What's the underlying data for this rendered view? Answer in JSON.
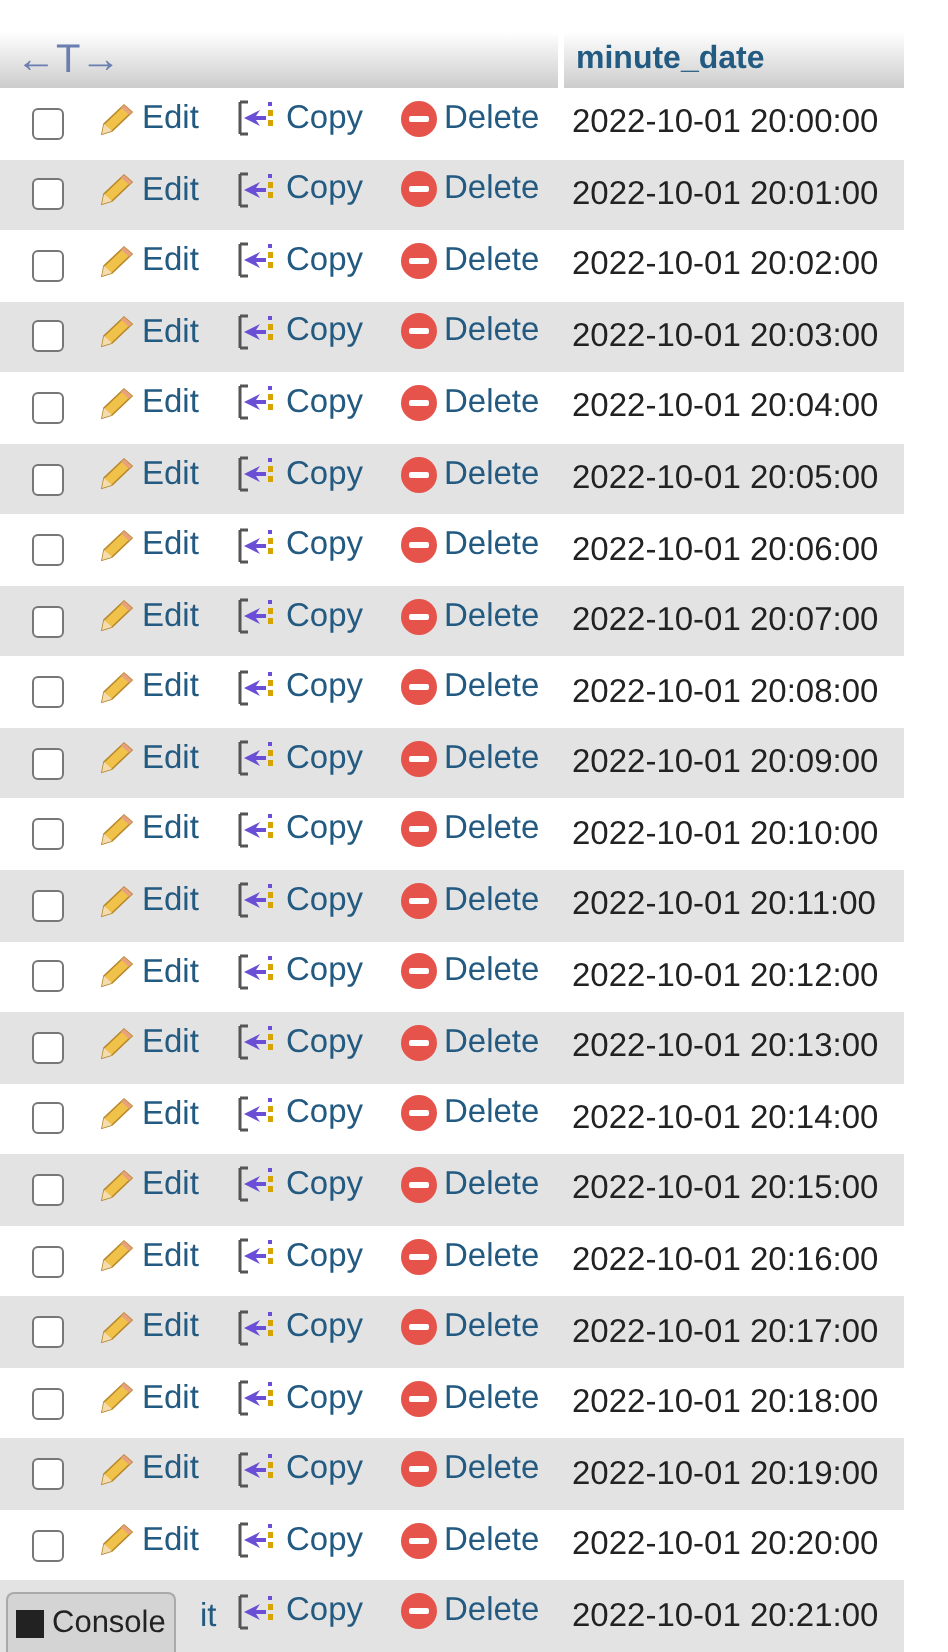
{
  "header": {
    "sort_arrows": "←T→",
    "column": "minute_date"
  },
  "rows": [
    {
      "kind": "full",
      "checked": false,
      "edit": "Edit",
      "copy": "Copy",
      "delete": "Delete",
      "minute_date": "2022-10-01 20:00:00"
    },
    {
      "kind": "full",
      "checked": false,
      "edit": "Edit",
      "copy": "Copy",
      "delete": "Delete",
      "minute_date": "2022-10-01 20:01:00"
    },
    {
      "kind": "full",
      "checked": false,
      "edit": "Edit",
      "copy": "Copy",
      "delete": "Delete",
      "minute_date": "2022-10-01 20:02:00"
    },
    {
      "kind": "full",
      "checked": false,
      "edit": "Edit",
      "copy": "Copy",
      "delete": "Delete",
      "minute_date": "2022-10-01 20:03:00"
    },
    {
      "kind": "full",
      "checked": false,
      "edit": "Edit",
      "copy": "Copy",
      "delete": "Delete",
      "minute_date": "2022-10-01 20:04:00"
    },
    {
      "kind": "full",
      "checked": false,
      "edit": "Edit",
      "copy": "Copy",
      "delete": "Delete",
      "minute_date": "2022-10-01 20:05:00"
    },
    {
      "kind": "full",
      "checked": false,
      "edit": "Edit",
      "copy": "Copy",
      "delete": "Delete",
      "minute_date": "2022-10-01 20:06:00"
    },
    {
      "kind": "full",
      "checked": false,
      "edit": "Edit",
      "copy": "Copy",
      "delete": "Delete",
      "minute_date": "2022-10-01 20:07:00"
    },
    {
      "kind": "full",
      "checked": false,
      "edit": "Edit",
      "copy": "Copy",
      "delete": "Delete",
      "minute_date": "2022-10-01 20:08:00"
    },
    {
      "kind": "full",
      "checked": false,
      "edit": "Edit",
      "copy": "Copy",
      "delete": "Delete",
      "minute_date": "2022-10-01 20:09:00"
    },
    {
      "kind": "full",
      "checked": false,
      "edit": "Edit",
      "copy": "Copy",
      "delete": "Delete",
      "minute_date": "2022-10-01 20:10:00"
    },
    {
      "kind": "full",
      "checked": false,
      "edit": "Edit",
      "copy": "Copy",
      "delete": "Delete",
      "minute_date": "2022-10-01 20:11:00"
    },
    {
      "kind": "full",
      "checked": false,
      "edit": "Edit",
      "copy": "Copy",
      "delete": "Delete",
      "minute_date": "2022-10-01 20:12:00"
    },
    {
      "kind": "full",
      "checked": false,
      "edit": "Edit",
      "copy": "Copy",
      "delete": "Delete",
      "minute_date": "2022-10-01 20:13:00"
    },
    {
      "kind": "full",
      "checked": false,
      "edit": "Edit",
      "copy": "Copy",
      "delete": "Delete",
      "minute_date": "2022-10-01 20:14:00"
    },
    {
      "kind": "full",
      "checked": false,
      "edit": "Edit",
      "copy": "Copy",
      "delete": "Delete",
      "minute_date": "2022-10-01 20:15:00"
    },
    {
      "kind": "full",
      "checked": false,
      "edit": "Edit",
      "copy": "Copy",
      "delete": "Delete",
      "minute_date": "2022-10-01 20:16:00"
    },
    {
      "kind": "full",
      "checked": false,
      "edit": "Edit",
      "copy": "Copy",
      "delete": "Delete",
      "minute_date": "2022-10-01 20:17:00"
    },
    {
      "kind": "full",
      "checked": false,
      "edit": "Edit",
      "copy": "Copy",
      "delete": "Delete",
      "minute_date": "2022-10-01 20:18:00"
    },
    {
      "kind": "full",
      "checked": false,
      "edit": "Edit",
      "copy": "Copy",
      "delete": "Delete",
      "minute_date": "2022-10-01 20:19:00"
    },
    {
      "kind": "full",
      "checked": false,
      "edit": "Edit",
      "copy": "Copy",
      "delete": "Delete",
      "minute_date": "2022-10-01 20:20:00"
    },
    {
      "kind": "covered",
      "edit": "it",
      "copy": "Copy",
      "delete": "Delete",
      "minute_date": "2022-10-01 20:21:00"
    }
  ],
  "console_button": "Console"
}
